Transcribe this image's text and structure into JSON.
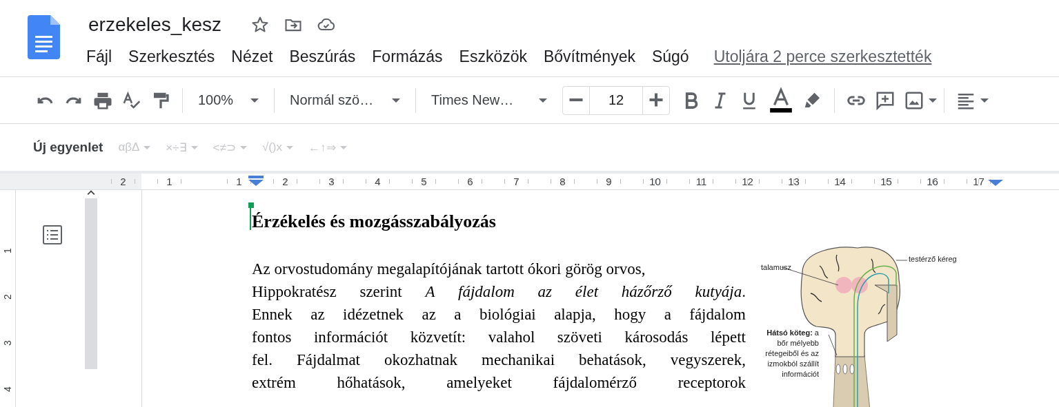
{
  "header": {
    "title": "erzekeles_kesz",
    "menu": [
      "Fájl",
      "Szerkesztés",
      "Nézet",
      "Beszúrás",
      "Formázás",
      "Eszközök",
      "Bővítmények",
      "Súgó"
    ],
    "last_edit": "Utoljára 2 perce szerkesztették"
  },
  "toolbar": {
    "zoom": "100%",
    "style": "Normál szö…",
    "font": "Times New…",
    "font_size": "12"
  },
  "equation_bar": {
    "new_equation": "Új egyenlet",
    "groups": [
      {
        "label": "αβΔ",
        "disabled": true
      },
      {
        "label": "×÷∃",
        "disabled": true
      },
      {
        "label": "<≠⊃",
        "disabled": true
      },
      {
        "label": "√()x",
        "disabled": true
      },
      {
        "label": "←↑⇒",
        "disabled": true
      }
    ]
  },
  "ruler": {
    "left_marks": [
      "2",
      "1"
    ],
    "marks": [
      "1",
      "2",
      "3",
      "4",
      "5",
      "6",
      "7",
      "8",
      "9",
      "10",
      "11",
      "12",
      "13",
      "14",
      "15",
      "16",
      "17"
    ]
  },
  "vertical_ruler": [
    "1",
    "2",
    "3",
    "4"
  ],
  "document": {
    "heading": "Érzékelés és mozgásszabályozás",
    "lines": [
      "Az orvostudomány megalapítójának tartott ókori görög orvos,",
      "Hippokratész szerint *A fájdalom az élet házőrző kutyája*.",
      "Ennek az idézetnek az a biológiai alapja, hogy a fájdalom",
      "fontos információt közvetít: valahol szöveti károsodás lépett",
      "fel. Fájdalmat okozhatnak mechanikai behatások, vegyszerek,",
      "extrém hőhatások, amelyeket fájdalomérző receptorok"
    ],
    "figure": {
      "labels": [
        "talamusz",
        "testérző kéreg",
        "**Hátsó köteg:** a bőr mélyebb rétegeiből és az izmokból szállít információt"
      ]
    }
  }
}
